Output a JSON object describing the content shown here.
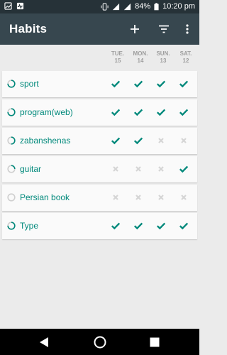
{
  "status_bar": {
    "battery": "84%",
    "time": "10:20 pm"
  },
  "app_bar": {
    "title": "Habits",
    "actions": [
      "add-icon",
      "filter-icon",
      "more-vert-icon"
    ]
  },
  "days": [
    {
      "name": "TUE.",
      "num": "15"
    },
    {
      "name": "MON.",
      "num": "14"
    },
    {
      "name": "SUN.",
      "num": "13"
    },
    {
      "name": "SAT.",
      "num": "12"
    }
  ],
  "habits": [
    {
      "name": "sport",
      "progress": 0.75,
      "checks": [
        true,
        true,
        true,
        true
      ]
    },
    {
      "name": "program(web)",
      "progress": 0.75,
      "checks": [
        true,
        true,
        true,
        true
      ]
    },
    {
      "name": "zabanshenas",
      "progress": 0.5,
      "checks": [
        true,
        true,
        false,
        false
      ]
    },
    {
      "name": "guitar",
      "progress": 0.25,
      "checks": [
        false,
        false,
        false,
        true
      ]
    },
    {
      "name": "Persian book",
      "progress": 0,
      "checks": [
        false,
        false,
        false,
        false
      ]
    },
    {
      "name": "Type",
      "progress": 0.75,
      "checks": [
        true,
        true,
        true,
        true
      ]
    }
  ],
  "colors": {
    "accent": "#00897b",
    "app_bar": "#37474f",
    "status_bar": "#263238",
    "unchecked": "#d5d5d5",
    "header_text": "#9e9e9e"
  }
}
